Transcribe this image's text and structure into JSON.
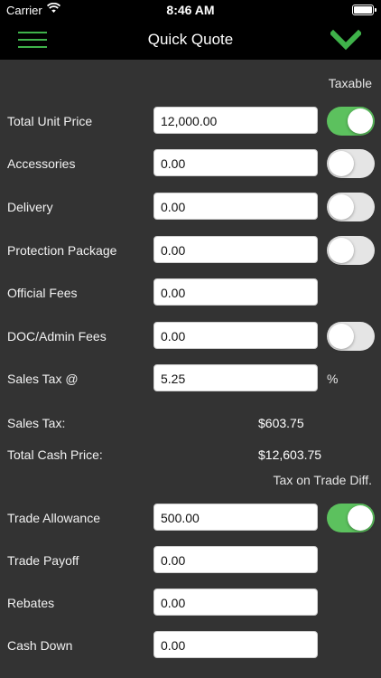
{
  "status_bar": {
    "carrier": "Carrier",
    "time": "8:46 AM"
  },
  "nav": {
    "title": "Quick Quote"
  },
  "colors": {
    "accent": "#3fb24a",
    "toggle_on": "#5cc15e",
    "background": "#333333"
  },
  "taxable_header": "Taxable",
  "rows_top": [
    {
      "label": "Total Unit Price",
      "value": "12,000.00",
      "toggle": "on"
    },
    {
      "label": "Accessories",
      "value": "0.00",
      "toggle": "off"
    },
    {
      "label": "Delivery",
      "value": "0.00",
      "toggle": "off"
    },
    {
      "label": "Protection Package",
      "value": "0.00",
      "toggle": "off"
    },
    {
      "label": "Official Fees",
      "value": "0.00"
    },
    {
      "label": "DOC/Admin Fees",
      "value": "0.00",
      "toggle": "off"
    },
    {
      "label": "Sales Tax @",
      "value": "5.25",
      "suffix": "%"
    }
  ],
  "sales_tax": {
    "label": "Sales Tax:",
    "value": "$603.75"
  },
  "total_cash_price": {
    "label": "Total Cash Price:",
    "value": "$12,603.75"
  },
  "trade_header": "Tax on Trade Diff.",
  "rows_bottom": [
    {
      "label": "Trade Allowance",
      "value": "500.00",
      "toggle": "on"
    },
    {
      "label": "Trade Payoff",
      "value": "0.00"
    },
    {
      "label": "Rebates",
      "value": "0.00"
    },
    {
      "label": "Cash Down",
      "value": "0.00"
    }
  ]
}
